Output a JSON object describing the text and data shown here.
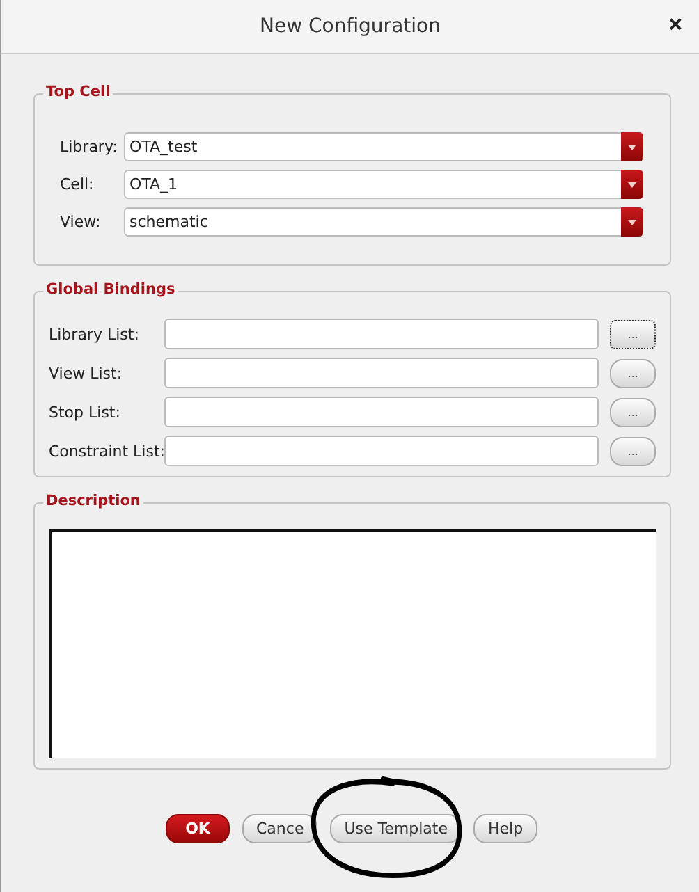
{
  "window": {
    "title": "New Configuration",
    "close": "×"
  },
  "top_cell": {
    "title": "Top Cell",
    "fields": [
      {
        "label": "Library:",
        "value": "OTA_test"
      },
      {
        "label": "Cell:",
        "value": "OTA_1"
      },
      {
        "label": "View:",
        "value": "schematic"
      }
    ]
  },
  "global_bindings": {
    "title": "Global Bindings",
    "fields": [
      {
        "label": "Library List:",
        "button": "...",
        "focused": true
      },
      {
        "label": "View List:",
        "button": "...",
        "focused": false
      },
      {
        "label": "Stop List:",
        "button": "...",
        "focused": false
      },
      {
        "label": "Constraint List:",
        "button": "...",
        "focused": false
      }
    ]
  },
  "description": {
    "title": "Description"
  },
  "buttons": [
    {
      "label": "OK",
      "kind": "primary"
    },
    {
      "label": "Cance",
      "kind": "normal"
    },
    {
      "label": "Use Template",
      "kind": "normal"
    },
    {
      "label": "Help",
      "kind": "normal"
    }
  ]
}
